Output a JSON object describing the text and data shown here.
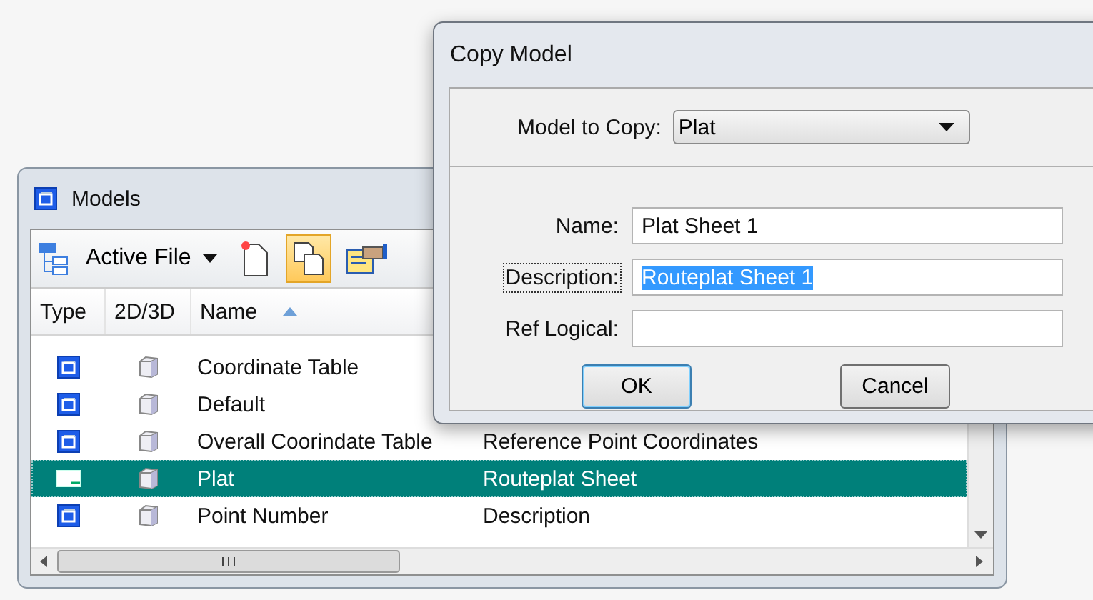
{
  "models_window": {
    "title": "Models",
    "toolbar": {
      "file_dropdown": "Active File"
    },
    "table": {
      "columns": [
        "Type",
        "2D/3D",
        "Name"
      ],
      "rows": [
        {
          "kind": "design",
          "name": "Coordinate Table",
          "selected": false
        },
        {
          "kind": "design",
          "name": "Default",
          "selected": false
        },
        {
          "kind": "design",
          "name": "Overall Coorindate Table",
          "description": "Reference Point Coordinates",
          "selected": false
        },
        {
          "kind": "sheet",
          "name": "Plat",
          "description": "Routeplat Sheet",
          "selected": true
        },
        {
          "kind": "design",
          "name": "Point Number",
          "description": "Description",
          "selected": false
        }
      ]
    }
  },
  "copy_dialog": {
    "title": "Copy Model",
    "model_to_copy": {
      "label": "Model to Copy:",
      "value": "Plat"
    },
    "fields": [
      {
        "label": "Name:",
        "value": "Plat Sheet 1",
        "focused": false
      },
      {
        "label": "Description:",
        "value": "Routeplat Sheet 1",
        "focused": true
      },
      {
        "label": "Ref Logical:",
        "focused": false
      }
    ],
    "buttons": [
      {
        "label": "OK",
        "default": true
      },
      {
        "label": "Cancel",
        "default": false
      }
    ]
  }
}
